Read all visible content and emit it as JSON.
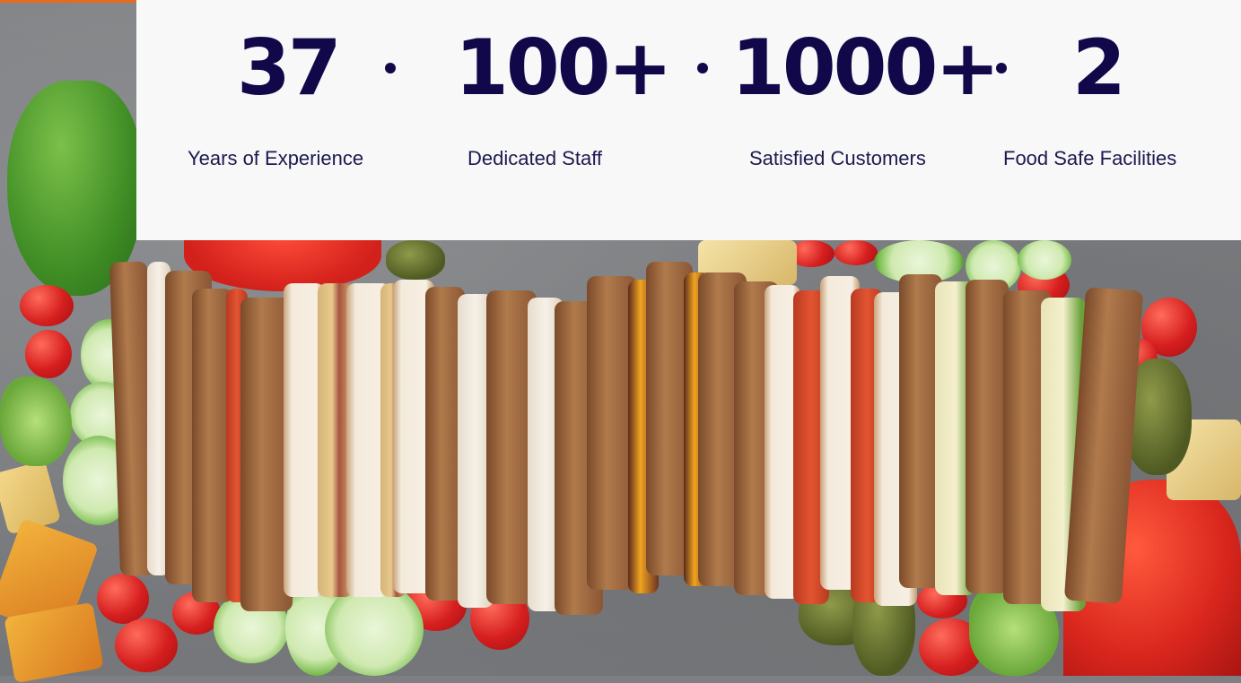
{
  "stats": [
    {
      "value": "37",
      "label": "Years of Experience"
    },
    {
      "value": "100+",
      "label": "Dedicated Staff"
    },
    {
      "value": "1000+",
      "label": "Satisfied Customers"
    },
    {
      "value": "2",
      "label": "Food Safe Facilities"
    }
  ],
  "separator": "·",
  "colors": {
    "heading": "#11084a",
    "panel_bg": "#f8f8f9",
    "accent": "#e96a1d"
  }
}
